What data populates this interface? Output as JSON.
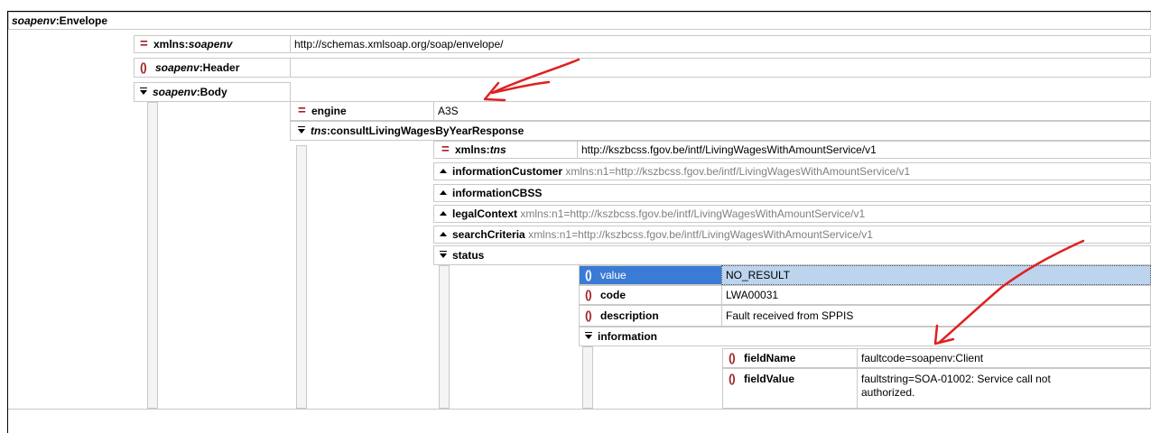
{
  "envelope": {
    "ns": "soapenv",
    "name": ":Envelope"
  },
  "xmlns_soapenv": {
    "pre": "xmlns:",
    "ns": "soapenv",
    "value": "http://schemas.xmlsoap.org/soap/envelope/"
  },
  "header": {
    "ns": "soapenv",
    "name": ":Header"
  },
  "body": {
    "ns": "soapenv",
    "name": ":Body"
  },
  "engine": {
    "label": "engine",
    "value": "A3S"
  },
  "response": {
    "ns": "tns",
    "name": ":consultLivingWagesByYearResponse"
  },
  "xmlns_tns": {
    "pre": "xmlns:",
    "ns": "tns",
    "value": "http://kszbcss.fgov.be/intf/LivingWagesWithAmountService/v1"
  },
  "information_customer": {
    "label": "informationCustomer",
    "attr": "xmlns:n1=http://kszbcss.fgov.be/intf/LivingWagesWithAmountService/v1"
  },
  "information_cbss": {
    "label": "informationCBSS"
  },
  "legal_context": {
    "label": "legalContext",
    "attr": "xmlns:n1=http://kszbcss.fgov.be/intf/LivingWagesWithAmountService/v1"
  },
  "search_criteria": {
    "label": "searchCriteria",
    "attr": "xmlns:n1=http://kszbcss.fgov.be/intf/LivingWagesWithAmountService/v1"
  },
  "status": {
    "label": "status",
    "value": {
      "label": "value",
      "value": "NO_RESULT"
    },
    "code": {
      "label": "code",
      "value": "LWA00031"
    },
    "description": {
      "label": "description",
      "value": "Fault received from SPPIS"
    },
    "information": {
      "label": "information",
      "field_name": {
        "label": "fieldName",
        "value": "faultcode=soapenv:Client"
      },
      "field_value": {
        "label": "fieldValue",
        "value": "faultstring=SOA-01002: Service call not authorized."
      }
    }
  },
  "icons": {
    "attribute": "=",
    "element": "()",
    "annotation_color": "#e02020",
    "element_icon_color": "#a0242a",
    "selection_color": "#bcd4ee"
  }
}
